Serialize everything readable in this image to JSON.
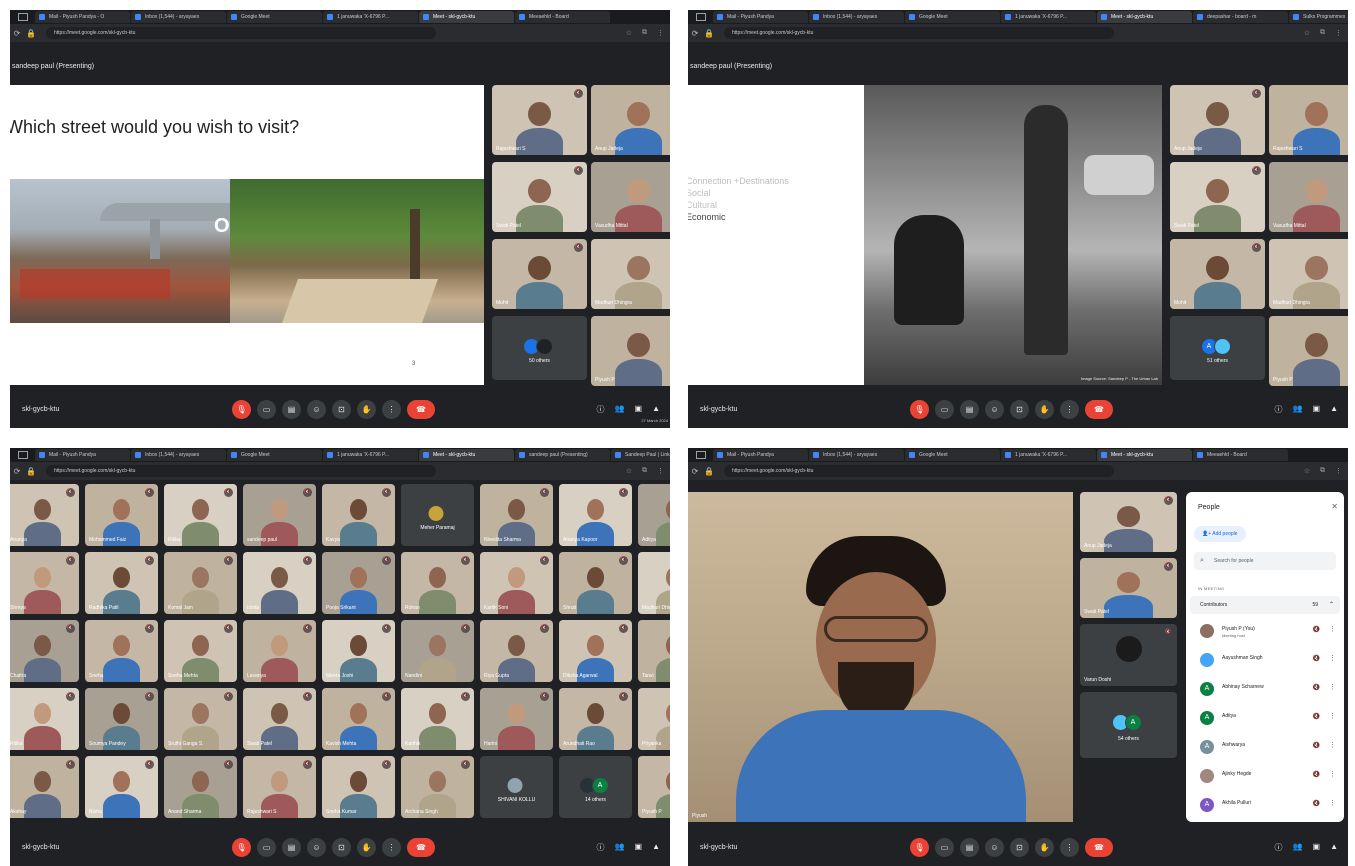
{
  "browser": {
    "tabs_p1": [
      "Mail - Piyush Pandya - O",
      "Inbox (1,544) - aryayaes",
      "Google Meet",
      "1 januwaka 'X-6796 P...",
      "Meet - skl-gycb-ktu",
      "Meeaehld - Board"
    ],
    "tabs_p2": [
      "Mail - Piyush Pandya",
      "Inbox (1,544) - aryayaes",
      "Google Meet",
      "1 januwaka 'X-6796 P...",
      "Meet - skl-gycb-ktu",
      "deepashar - board - m",
      "Sulks Programmes"
    ],
    "tabs_p3": [
      "Mail - Piyush Pandya",
      "Inbox (1,544) - aryayaes",
      "Google Meet",
      "1 januwaka 'X-6796 P...",
      "Meet - skl-gycb-ktu",
      "sandeep paul (Presenting)",
      "Sandeep Paul | LinkedIn"
    ],
    "tabs_p4": [
      "Mail - Piyush Pandya",
      "Inbox (1,544) - aryayaes",
      "Google Meet",
      "1 januwaka 'X-6796 P...",
      "Meet - skl-gycb-ktu",
      "Meeaehld - Board"
    ],
    "url": "https://meet.google.com/skl-gycb-ktu"
  },
  "meeting": {
    "presenting": "sandeep paul (Presenting)",
    "code": "skl-gycb-ktu",
    "date": "27 March 2024",
    "participant_count": "60"
  },
  "panel1": {
    "slide_title": "Which street would you wish to visit?",
    "or_label": "Or",
    "page_number": "3",
    "tiles": [
      {
        "name": "Rajeshwari S"
      },
      {
        "name": "Anup Jadeja"
      },
      {
        "name": "Swati Patel"
      },
      {
        "name": "Vasudha Mittal"
      },
      {
        "name": "Mohit"
      },
      {
        "name": "Madhuri Dhingra"
      },
      {
        "name": "Piyush P"
      }
    ],
    "others_label": "50 others"
  },
  "panel2": {
    "slide_lines": [
      "Connection +Destinations",
      "Social",
      "Cultural",
      "Economic"
    ],
    "image_credit": "Image Source: Sandeep P - The Urban Lab",
    "tiles": [
      {
        "name": "Anup Jadeja"
      },
      {
        "name": "Rajeshwari S"
      },
      {
        "name": "Swati Patel"
      },
      {
        "name": "Vasudha Mittal"
      },
      {
        "name": "Mohit"
      },
      {
        "name": "Madhuri Dhingra"
      },
      {
        "name": "Piyush P"
      }
    ],
    "others_label": "51 others"
  },
  "panel3": {
    "grid_names": [
      "Ananya",
      "Mohammed Faiz",
      "Ritika",
      "sandeep paul",
      "Kavya",
      "Meher Paramaj",
      "Nivedita Sharma",
      "Ananya Kapoor",
      "Aditya",
      "Shreya",
      "Radhika Patil",
      "Komal Jain",
      "Ishita",
      "Pooja Srikant",
      "Rohan",
      "Kartik Soni",
      "Shruti",
      "Madhuri Dhingra",
      "Chaitra",
      "Sneha",
      "Sneha Mehta",
      "Lavanya",
      "Meera Joshi",
      "Nandini",
      "Riya Gupta",
      "Diksha Agarwal",
      "Tanvi",
      "Ritika",
      "Soumya Pandey",
      "Sruthi Ganga S.",
      "Swati Patel",
      "Kavish Mehta",
      "Karthik",
      "Harini",
      "Arundhati Rao",
      "Priyanka",
      "Akshay",
      "Nisha",
      "Anand Sharma",
      "Rajeshwari S",
      "Sneha Kumar",
      "Archana Singh",
      "SHIVANI KOLLU",
      "14 others",
      "Piyush P"
    ]
  },
  "panel4": {
    "speaker_name": "Piyush",
    "tiles": [
      {
        "name": "Anup Jadeja"
      },
      {
        "name": "Swati Patel"
      },
      {
        "name": "Varun Doshi"
      }
    ],
    "others_label": "54 others",
    "people": {
      "title": "People",
      "add_label": "Add people",
      "search_placeholder": "Search for people",
      "section_label": "IN MEETING",
      "group_label": "Contributors",
      "group_count": "59",
      "list": [
        {
          "name": "Piyush P (You)",
          "sub": "Meeting host",
          "avatar": "",
          "color": "#8d6e63"
        },
        {
          "name": "Aayushman Singh",
          "sub": "",
          "avatar": "",
          "color": "#42a5f5"
        },
        {
          "name": "Abhinay Scharnew",
          "sub": "",
          "avatar": "A",
          "color": "#0b8043"
        },
        {
          "name": "Aditya",
          "sub": "",
          "avatar": "A",
          "color": "#0b8043"
        },
        {
          "name": "Aishwarya",
          "sub": "",
          "avatar": "A",
          "color": "#78909c"
        },
        {
          "name": "Ajinky Hegde",
          "sub": "",
          "avatar": "",
          "color": "#a1887f"
        },
        {
          "name": "Akhila Pulluri",
          "sub": "",
          "avatar": "A",
          "color": "#7e57c2"
        }
      ]
    }
  }
}
